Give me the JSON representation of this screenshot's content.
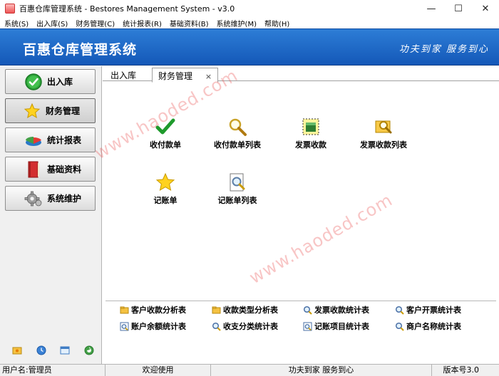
{
  "window": {
    "title": "百惠仓库管理系统 - Bestores Management System - v3.0",
    "minimize": "—",
    "maximize": "☐",
    "close": "✕"
  },
  "menu": [
    "系统(S)",
    "出入库(S)",
    "财务管理(C)",
    "统计报表(R)",
    "基础资料(B)",
    "系统维护(M)",
    "帮助(H)"
  ],
  "banner": {
    "title": "百惠仓库管理系统",
    "slogan": "功夫到家 服务到心"
  },
  "sidebar": {
    "items": [
      {
        "label": "出入库",
        "icon": "check-circle-icon"
      },
      {
        "label": "财务管理",
        "icon": "star-icon"
      },
      {
        "label": "统计报表",
        "icon": "pie-chart-icon"
      },
      {
        "label": "基础资料",
        "icon": "book-icon"
      },
      {
        "label": "系统维护",
        "icon": "gear-icon"
      }
    ]
  },
  "tabs": [
    {
      "label": "出入库",
      "active": false
    },
    {
      "label": "财务管理",
      "active": true,
      "close": "×"
    }
  ],
  "functions": [
    {
      "label": "收付款单",
      "icon": "checkmark-icon"
    },
    {
      "label": "收付款单列表",
      "icon": "magnifier-icon"
    },
    {
      "label": "发票收款",
      "icon": "green-box-icon"
    },
    {
      "label": "发票收款列表",
      "icon": "folder-search-icon"
    },
    {
      "label": "记账单",
      "icon": "star-icon"
    },
    {
      "label": "记账单列表",
      "icon": "document-search-icon"
    }
  ],
  "reports": [
    {
      "label": "客户收款分析表",
      "icon": "folder-icon"
    },
    {
      "label": "收款类型分析表",
      "icon": "folder-icon"
    },
    {
      "label": "发票收款统计表",
      "icon": "search-icon"
    },
    {
      "label": "客户开票统计表",
      "icon": "search-icon"
    },
    {
      "label": "账户余额统计表",
      "icon": "window-search-icon"
    },
    {
      "label": "收支分类统计表",
      "icon": "search-icon"
    },
    {
      "label": "记账项目统计表",
      "icon": "window-search-icon"
    },
    {
      "label": "商户名称统计表",
      "icon": "search-icon"
    }
  ],
  "watermark": "www.haoded.com",
  "status": {
    "user": "用户名:管理员",
    "welcome": "欢迎使用",
    "slogan": "功夫到家 服务到心",
    "version": "版本号3.0"
  }
}
